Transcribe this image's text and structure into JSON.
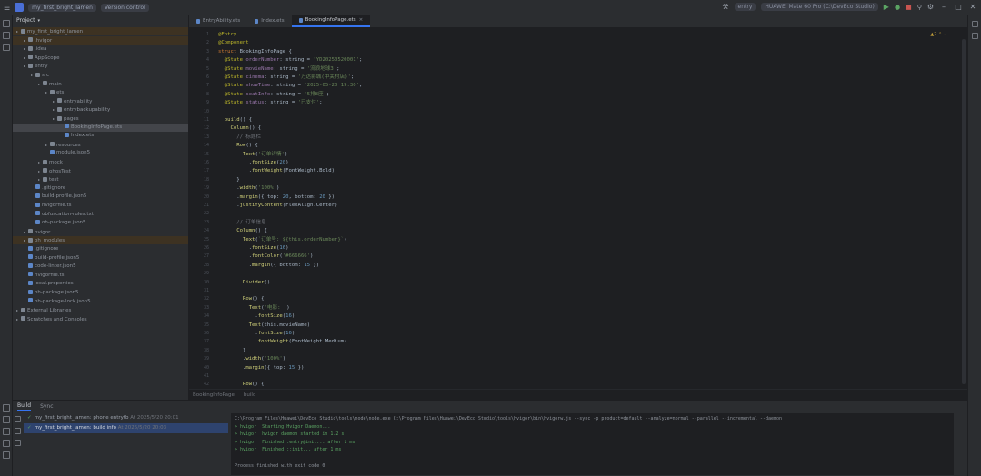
{
  "titlebar": {
    "project_name": "my_first_bright_lamen",
    "vcs": "Version control",
    "device": "entry",
    "device_target": "HUAWEI Mate 60 Pro (C:\\DevEco Studio)"
  },
  "project_panel": {
    "title": "Project",
    "items": [
      {
        "label": "my_first_bright_lamen",
        "indent": 0,
        "state": "hl",
        "icon": "folder"
      },
      {
        "label": ".hvigor",
        "indent": 1,
        "state": "hl",
        "icon": "folder"
      },
      {
        "label": ".idea",
        "indent": 1,
        "state": "",
        "icon": "folder"
      },
      {
        "label": "AppScope",
        "indent": 1,
        "state": "",
        "icon": "folder"
      },
      {
        "label": "entry",
        "indent": 1,
        "state": "",
        "icon": "folder"
      },
      {
        "label": "src",
        "indent": 2,
        "state": "",
        "icon": "folder"
      },
      {
        "label": "main",
        "indent": 3,
        "state": "",
        "icon": "folder"
      },
      {
        "label": "ets",
        "indent": 4,
        "state": "",
        "icon": "folder"
      },
      {
        "label": "entryability",
        "indent": 5,
        "state": "",
        "icon": "folder"
      },
      {
        "label": "entrybackupability",
        "indent": 5,
        "state": "",
        "icon": "folder"
      },
      {
        "label": "pages",
        "indent": 5,
        "state": "",
        "icon": "folder"
      },
      {
        "label": "BookingInfoPage.ets",
        "indent": 6,
        "state": "sel",
        "icon": "file"
      },
      {
        "label": "Index.ets",
        "indent": 6,
        "state": "",
        "icon": "file"
      },
      {
        "label": "resources",
        "indent": 4,
        "state": "",
        "icon": "folder"
      },
      {
        "label": "module.json5",
        "indent": 4,
        "state": "",
        "icon": "file"
      },
      {
        "label": "mock",
        "indent": 3,
        "state": "",
        "icon": "folder"
      },
      {
        "label": "ohosTest",
        "indent": 3,
        "state": "",
        "icon": "folder"
      },
      {
        "label": "test",
        "indent": 3,
        "state": "",
        "icon": "folder"
      },
      {
        "label": ".gitignore",
        "indent": 2,
        "state": "",
        "icon": "file"
      },
      {
        "label": "build-profile.json5",
        "indent": 2,
        "state": "",
        "icon": "file"
      },
      {
        "label": "hvigorfile.ts",
        "indent": 2,
        "state": "",
        "icon": "file"
      },
      {
        "label": "obfuscation-rules.txt",
        "indent": 2,
        "state": "",
        "icon": "file"
      },
      {
        "label": "oh-package.json5",
        "indent": 2,
        "state": "",
        "icon": "file"
      },
      {
        "label": "hvigor",
        "indent": 1,
        "state": "",
        "icon": "folder"
      },
      {
        "label": "oh_modules",
        "indent": 1,
        "state": "hl",
        "icon": "folder"
      },
      {
        "label": ".gitignore",
        "indent": 1,
        "state": "",
        "icon": "file"
      },
      {
        "label": "build-profile.json5",
        "indent": 1,
        "state": "",
        "icon": "file"
      },
      {
        "label": "code-linter.json5",
        "indent": 1,
        "state": "",
        "icon": "file"
      },
      {
        "label": "hvigorfile.ts",
        "indent": 1,
        "state": "",
        "icon": "file"
      },
      {
        "label": "local.properties",
        "indent": 1,
        "state": "",
        "icon": "file"
      },
      {
        "label": "oh-package.json5",
        "indent": 1,
        "state": "",
        "icon": "file"
      },
      {
        "label": "oh-package-lock.json5",
        "indent": 1,
        "state": "",
        "icon": "file"
      },
      {
        "label": "External Libraries",
        "indent": 0,
        "state": "",
        "icon": "folder"
      },
      {
        "label": "Scratches and Consoles",
        "indent": 0,
        "state": "",
        "icon": "folder"
      }
    ]
  },
  "tabs": [
    {
      "label": "EntryAbility.ets",
      "active": false
    },
    {
      "label": "Index.ets",
      "active": false
    },
    {
      "label": "BookingInfoPage.ets",
      "active": true
    }
  ],
  "editor": {
    "breadcrumb": "BookingInfoPage",
    "breadcrumb2": "build",
    "lines": [
      [
        {
          "c": "d",
          "t": "@Entry"
        }
      ],
      [
        {
          "c": "d",
          "t": "@Component"
        }
      ],
      [
        {
          "c": "k",
          "t": "struct "
        },
        {
          "c": "t",
          "t": "BookingInfoPage {"
        }
      ],
      [
        {
          "c": "t",
          "t": "  "
        },
        {
          "c": "d",
          "t": "@State "
        },
        {
          "c": "p",
          "t": "orderNumber"
        },
        {
          "c": "t",
          "t": ": string = "
        },
        {
          "c": "s",
          "t": "'YD20250520001'"
        },
        {
          "c": "t",
          "t": ";"
        }
      ],
      [
        {
          "c": "t",
          "t": "  "
        },
        {
          "c": "d",
          "t": "@State "
        },
        {
          "c": "p",
          "t": "movieName"
        },
        {
          "c": "t",
          "t": ": string = "
        },
        {
          "c": "s",
          "t": "'流浪地球3'"
        },
        {
          "c": "t",
          "t": ";"
        }
      ],
      [
        {
          "c": "t",
          "t": "  "
        },
        {
          "c": "d",
          "t": "@State "
        },
        {
          "c": "p",
          "t": "cinema"
        },
        {
          "c": "t",
          "t": ": string = "
        },
        {
          "c": "s",
          "t": "'万达影城(中关村店)'"
        },
        {
          "c": "t",
          "t": ";"
        }
      ],
      [
        {
          "c": "t",
          "t": "  "
        },
        {
          "c": "d",
          "t": "@State "
        },
        {
          "c": "p",
          "t": "showTime"
        },
        {
          "c": "t",
          "t": ": string = "
        },
        {
          "c": "s",
          "t": "'2025-05-20 19:30'"
        },
        {
          "c": "t",
          "t": ";"
        }
      ],
      [
        {
          "c": "t",
          "t": "  "
        },
        {
          "c": "d",
          "t": "@State "
        },
        {
          "c": "p",
          "t": "seatInfo"
        },
        {
          "c": "t",
          "t": ": string = "
        },
        {
          "c": "s",
          "t": "'5排8座'"
        },
        {
          "c": "t",
          "t": ";"
        }
      ],
      [
        {
          "c": "t",
          "t": "  "
        },
        {
          "c": "d",
          "t": "@State "
        },
        {
          "c": "p",
          "t": "status"
        },
        {
          "c": "t",
          "t": ": string = "
        },
        {
          "c": "s",
          "t": "'已支付'"
        },
        {
          "c": "t",
          "t": ";"
        }
      ],
      [],
      [
        {
          "c": "t",
          "t": "  "
        },
        {
          "c": "f",
          "t": "build"
        },
        {
          "c": "t",
          "t": "() {"
        }
      ],
      [
        {
          "c": "t",
          "t": "    "
        },
        {
          "c": "f",
          "t": "Column"
        },
        {
          "c": "t",
          "t": "() {"
        }
      ],
      [
        {
          "c": "c",
          "t": "      // 标题栏"
        }
      ],
      [
        {
          "c": "t",
          "t": "      "
        },
        {
          "c": "f",
          "t": "Row"
        },
        {
          "c": "t",
          "t": "() {"
        }
      ],
      [
        {
          "c": "t",
          "t": "        "
        },
        {
          "c": "f",
          "t": "Text"
        },
        {
          "c": "t",
          "t": "("
        },
        {
          "c": "s",
          "t": "'订单详情'"
        },
        {
          "c": "t",
          "t": ")"
        }
      ],
      [
        {
          "c": "t",
          "t": "          ."
        },
        {
          "c": "f",
          "t": "fontSize"
        },
        {
          "c": "t",
          "t": "("
        },
        {
          "c": "n",
          "t": "20"
        },
        {
          "c": "t",
          "t": ")"
        }
      ],
      [
        {
          "c": "t",
          "t": "          ."
        },
        {
          "c": "f",
          "t": "fontWeight"
        },
        {
          "c": "t",
          "t": "(FontWeight.Bold)"
        }
      ],
      [
        {
          "c": "t",
          "t": "      }"
        }
      ],
      [
        {
          "c": "t",
          "t": "      ."
        },
        {
          "c": "f",
          "t": "width"
        },
        {
          "c": "t",
          "t": "("
        },
        {
          "c": "s",
          "t": "'100%'"
        },
        {
          "c": "t",
          "t": ")"
        }
      ],
      [
        {
          "c": "t",
          "t": "      ."
        },
        {
          "c": "f",
          "t": "margin"
        },
        {
          "c": "t",
          "t": "({ top: "
        },
        {
          "c": "n",
          "t": "20"
        },
        {
          "c": "t",
          "t": ", bottom: "
        },
        {
          "c": "n",
          "t": "20"
        },
        {
          "c": "t",
          "t": " })"
        }
      ],
      [
        {
          "c": "t",
          "t": "      ."
        },
        {
          "c": "f",
          "t": "justifyContent"
        },
        {
          "c": "t",
          "t": "(FlexAlign.Center)"
        }
      ],
      [],
      [
        {
          "c": "c",
          "t": "      // 订单信息"
        }
      ],
      [
        {
          "c": "t",
          "t": "      "
        },
        {
          "c": "f",
          "t": "Column"
        },
        {
          "c": "t",
          "t": "() {"
        }
      ],
      [
        {
          "c": "t",
          "t": "        "
        },
        {
          "c": "f",
          "t": "Text"
        },
        {
          "c": "t",
          "t": "("
        },
        {
          "c": "s",
          "t": "`订单号: ${this.orderNumber}`"
        },
        {
          "c": "t",
          "t": ")"
        }
      ],
      [
        {
          "c": "t",
          "t": "          ."
        },
        {
          "c": "f",
          "t": "fontSize"
        },
        {
          "c": "t",
          "t": "("
        },
        {
          "c": "n",
          "t": "16"
        },
        {
          "c": "t",
          "t": ")"
        }
      ],
      [
        {
          "c": "t",
          "t": "          ."
        },
        {
          "c": "f",
          "t": "fontColor"
        },
        {
          "c": "t",
          "t": "("
        },
        {
          "c": "s",
          "t": "'#666666'"
        },
        {
          "c": "t",
          "t": ")"
        }
      ],
      [
        {
          "c": "t",
          "t": "          ."
        },
        {
          "c": "f",
          "t": "margin"
        },
        {
          "c": "t",
          "t": "({ bottom: "
        },
        {
          "c": "n",
          "t": "15"
        },
        {
          "c": "t",
          "t": " })"
        }
      ],
      [],
      [
        {
          "c": "t",
          "t": "        "
        },
        {
          "c": "f",
          "t": "Divider"
        },
        {
          "c": "t",
          "t": "()"
        }
      ],
      [],
      [
        {
          "c": "t",
          "t": "        "
        },
        {
          "c": "f",
          "t": "Row"
        },
        {
          "c": "t",
          "t": "() {"
        }
      ],
      [
        {
          "c": "t",
          "t": "          "
        },
        {
          "c": "f",
          "t": "Text"
        },
        {
          "c": "t",
          "t": "("
        },
        {
          "c": "s",
          "t": "'电影: '"
        },
        {
          "c": "t",
          "t": ")"
        }
      ],
      [
        {
          "c": "t",
          "t": "            ."
        },
        {
          "c": "f",
          "t": "fontSize"
        },
        {
          "c": "t",
          "t": "("
        },
        {
          "c": "n",
          "t": "16"
        },
        {
          "c": "t",
          "t": ")"
        }
      ],
      [
        {
          "c": "t",
          "t": "          "
        },
        {
          "c": "f",
          "t": "Text"
        },
        {
          "c": "t",
          "t": "(this.movieName)"
        }
      ],
      [
        {
          "c": "t",
          "t": "            ."
        },
        {
          "c": "f",
          "t": "fontSize"
        },
        {
          "c": "t",
          "t": "("
        },
        {
          "c": "n",
          "t": "16"
        },
        {
          "c": "t",
          "t": ")"
        }
      ],
      [
        {
          "c": "t",
          "t": "            ."
        },
        {
          "c": "f",
          "t": "fontWeight"
        },
        {
          "c": "t",
          "t": "(FontWeight.Medium)"
        }
      ],
      [
        {
          "c": "t",
          "t": "        }"
        }
      ],
      [
        {
          "c": "t",
          "t": "        ."
        },
        {
          "c": "f",
          "t": "width"
        },
        {
          "c": "t",
          "t": "("
        },
        {
          "c": "s",
          "t": "'100%'"
        },
        {
          "c": "t",
          "t": ")"
        }
      ],
      [
        {
          "c": "t",
          "t": "        ."
        },
        {
          "c": "f",
          "t": "margin"
        },
        {
          "c": "t",
          "t": "({ top: "
        },
        {
          "c": "n",
          "t": "15"
        },
        {
          "c": "t",
          "t": " })"
        }
      ],
      [],
      [
        {
          "c": "t",
          "t": "        "
        },
        {
          "c": "f",
          "t": "Row"
        },
        {
          "c": "t",
          "t": "() {"
        }
      ]
    ]
  },
  "build_panel": {
    "tabs": [
      "Build",
      "Sync"
    ],
    "items": [
      {
        "label": "my_first_bright_lamen: phone entrytb",
        "suffix": "At 2025/5/20 20:01",
        "selected": false
      },
      {
        "label": "my_first_bright_lamen: build info",
        "suffix": "At 2025/5/20 20:03",
        "selected": true
      }
    ],
    "output": [
      {
        "text": "C:\\Program Files\\Huawei\\DevEco Studio\\tools\\node\\node.exe C:\\Program Files\\Huawei\\DevEco Studio\\tools\\hvigor\\bin\\hvigorw.js --sync -p product=default --analyze=normal --parallel --incremental --daemon",
        "green": false
      },
      {
        "text": "> hvigor  Starting Hvigor Daemon...",
        "green": true
      },
      {
        "text": "> hvigor  hvigor daemon started in 1.2 s",
        "green": true
      },
      {
        "text": "> hvigor  Finished :entry@init... after 1 ms",
        "green": true
      },
      {
        "text": "> hvigor  Finished ::init... after 1 ms",
        "green": true
      },
      {
        "text": "",
        "green": false
      },
      {
        "text": "Process finished with exit code 0",
        "green": false
      }
    ]
  }
}
